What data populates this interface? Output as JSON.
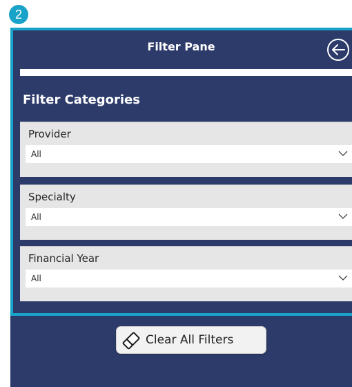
{
  "step_badge": "2",
  "pane": {
    "title": "Filter Pane",
    "section_title": "Filter Categories"
  },
  "filters": [
    {
      "label": "Provider",
      "value": "All"
    },
    {
      "label": "Specialty",
      "value": "All"
    },
    {
      "label": "Financial Year",
      "value": "All"
    }
  ],
  "clear_button": {
    "label": "Clear All Filters"
  },
  "icons": {
    "back": "arrow-left-circle-icon",
    "dropdown": "chevron-down-icon",
    "clear": "eraser-icon"
  },
  "colors": {
    "pane_background": "#2d3b6b",
    "highlight_border": "#1aa3c8",
    "card_background": "#e6e6e6"
  }
}
